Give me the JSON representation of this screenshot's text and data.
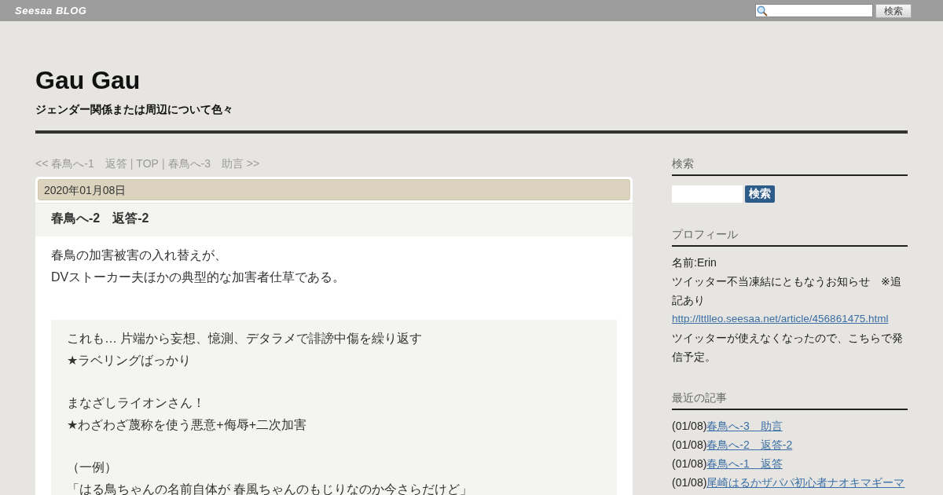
{
  "top_bar": {
    "logo": "Seesaa BLOG",
    "search": {
      "button": "検索"
    }
  },
  "blog": {
    "title": "Gau Gau",
    "subtitle": "ジェンダー関係または周辺について色々"
  },
  "nav": [
    {
      "kind": "link",
      "text": "<< 春鳥へ-1　返答"
    },
    {
      "kind": "sep",
      "text": "|"
    },
    {
      "kind": "link",
      "text": "TOP"
    },
    {
      "kind": "sep",
      "text": "|"
    },
    {
      "kind": "link",
      "text": "春鳥へ-3　助言 >>"
    }
  ],
  "article": {
    "date": "2020年01月08日",
    "title": "春鳥へ-2　返答-2",
    "paragraphs": [
      "春鳥の加害被害の入れ替えが、",
      "DVストーカー夫ほかの典型的な加害者仕草である。"
    ],
    "quote": [
      [
        "これも… 片端から妄想、憶測、デタラメで誹謗中傷を繰り返す",
        "★ラベリングばっかり"
      ],
      [
        "まなざしライオンさん！",
        "★わざわざ蔑称を使う悪意+侮辱+二次加害"
      ],
      [
        "（一例）",
        "「はる鳥ちゃんの名前自体が 春風ちゃんのもじりなのか今さらだけど」"
      ]
    ]
  },
  "sidebar": {
    "search": {
      "heading": "検索",
      "button": "検索"
    },
    "profile": {
      "heading": "プロフィール",
      "lines": [
        {
          "kind": "text",
          "text": "名前:Erin"
        },
        {
          "kind": "text",
          "text": "ツイッター不当凍結にともなうお知らせ　※追記あり"
        },
        {
          "kind": "link",
          "text": "http://lttlleo.seesaa.net/article/456861475.html"
        },
        {
          "kind": "text",
          "text": "ツイッターが使えなくなったので、こちらで発信予定。"
        }
      ]
    },
    "recent": {
      "heading": "最近の記事",
      "items": [
        {
          "date": "(01/08)",
          "title": "春鳥へ-3　助言"
        },
        {
          "date": "(01/08)",
          "title": "春鳥へ-2　返答-2"
        },
        {
          "date": "(01/08)",
          "title": "春鳥へ-1　返答"
        },
        {
          "date": "(01/08)",
          "title": "尾崎はるかザパパ初心者ナオキマギーマ"
        }
      ]
    }
  }
}
